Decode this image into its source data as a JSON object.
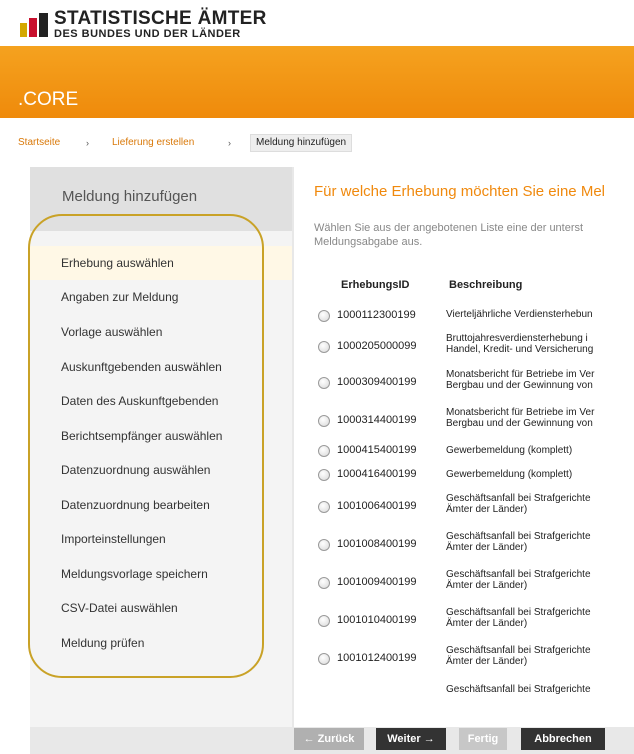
{
  "header": {
    "logo_line1": "STATISTISCHE ÄMTER",
    "logo_line2": "DES BUNDES UND DER LÄNDER",
    "app_name": ".CORE"
  },
  "breadcrumb": {
    "home": "Startseite",
    "sep1": "›",
    "step": "Lieferung erstellen",
    "sep2": "›",
    "current": "Meldung hinzufügen"
  },
  "sidebar": {
    "title": "Meldung hinzufügen",
    "items": [
      {
        "label": "Erhebung auswählen",
        "active": true
      },
      {
        "label": "Angaben zur Meldung"
      },
      {
        "label": "Vorlage auswählen"
      },
      {
        "label": "Auskunftgebenden auswählen"
      },
      {
        "label": "Daten des Auskunftgebenden"
      },
      {
        "label": "Berichtsempfänger auswählen"
      },
      {
        "label": "Datenzuordnung auswählen"
      },
      {
        "label": "Datenzuordnung bearbeiten"
      },
      {
        "label": "Importeinstellungen"
      },
      {
        "label": "Meldungsvorlage speichern"
      },
      {
        "label": "CSV-Datei auswählen"
      },
      {
        "label": "Meldung prüfen"
      }
    ]
  },
  "content": {
    "title": "Für welche Erhebung möchten Sie eine Mel",
    "desc_line1": "Wählen Sie aus der angebotenen Liste eine der unterst",
    "desc_line2": "Meldungsabgabe aus.",
    "col_id": "ErhebungsID",
    "col_desc": "Beschreibung",
    "rows": [
      {
        "id": "1000112300199",
        "d1": "Vierteljährliche Verdiensterhebun",
        "d2": ""
      },
      {
        "id": "1000205000099",
        "d1": "Bruttojahresverdiensterhebung i",
        "d2": "Handel, Kredit- und Versicherung"
      },
      {
        "id": "1000309400199",
        "d1": "Monatsbericht für Betriebe im Ver",
        "d2": "Bergbau und der Gewinnung von"
      },
      {
        "id": "1000314400199",
        "d1": "Monatsbericht für Betriebe im Ver",
        "d2": "Bergbau und der Gewinnung von"
      },
      {
        "id": "1000415400199",
        "d1": "Gewerbemeldung (komplett)",
        "d2": ""
      },
      {
        "id": "1000416400199",
        "d1": "Gewerbemeldung (komplett)",
        "d2": ""
      },
      {
        "id": "1001006400199",
        "d1": "Geschäftsanfall bei Strafgerichte",
        "d2": "Ämter der Länder)"
      },
      {
        "id": "1001008400199",
        "d1": "Geschäftsanfall bei Strafgerichte",
        "d2": "Ämter der Länder)"
      },
      {
        "id": "1001009400199",
        "d1": "Geschäftsanfall bei Strafgerichte",
        "d2": "Ämter der Länder)"
      },
      {
        "id": "1001010400199",
        "d1": "Geschäftsanfall bei Strafgerichte",
        "d2": "Ämter der Länder)"
      },
      {
        "id": "1001012400199",
        "d1": "Geschäftsanfall bei Strafgerichte",
        "d2": "Ämter der Länder)"
      },
      {
        "id": "",
        "d1": "Geschäftsanfall bei Strafgerichte",
        "d2": ""
      }
    ]
  },
  "buttons": {
    "back": "← Zurück",
    "next": "Weiter →",
    "finish": "Fertig",
    "cancel": "Abbrechen"
  },
  "colors": {
    "brand_orange": "#ef8a0b",
    "highlight": "#c9a227"
  }
}
